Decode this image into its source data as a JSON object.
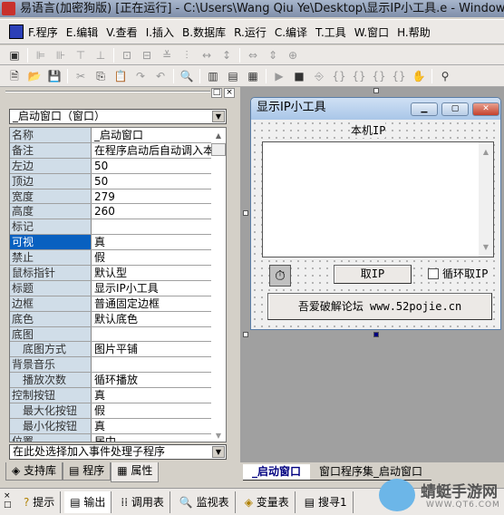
{
  "title": "易语言(加密狗版) [正在运行] - C:\\Users\\Wang Qiu Ye\\Desktop\\显示IP小工具.e - Windows窗口程",
  "menu": [
    "F.程序",
    "E.编辑",
    "V.查看",
    "I.插入",
    "B.数据库",
    "R.运行",
    "C.编译",
    "T.工具",
    "W.窗口",
    "H.帮助"
  ],
  "properties": {
    "object_combo": "_启动窗口（窗口）",
    "rows": [
      {
        "k": "名称",
        "v": "_启动窗口"
      },
      {
        "k": "备注",
        "v": "在程序启动后自动调入本"
      },
      {
        "k": "左边",
        "v": "50"
      },
      {
        "k": "顶边",
        "v": "50"
      },
      {
        "k": "宽度",
        "v": "279"
      },
      {
        "k": "高度",
        "v": "260"
      },
      {
        "k": "标记",
        "v": ""
      },
      {
        "k": "可视",
        "v": "真"
      },
      {
        "k": "禁止",
        "v": "假"
      },
      {
        "k": "鼠标指针",
        "v": "默认型"
      },
      {
        "k": "标题",
        "v": "显示IP小工具"
      },
      {
        "k": "边框",
        "v": "普通固定边框"
      },
      {
        "k": "底色",
        "v": "默认底色"
      },
      {
        "k": "底图",
        "v": ""
      },
      {
        "k": "底图方式",
        "v": "图片平铺"
      },
      {
        "k": "背景音乐",
        "v": ""
      },
      {
        "k": "播放次数",
        "v": "循环播放"
      },
      {
        "k": "控制按钮",
        "v": "真"
      },
      {
        "k": "最大化按钮",
        "v": "假"
      },
      {
        "k": "最小化按钮",
        "v": "真"
      },
      {
        "k": "位置",
        "v": "居中"
      }
    ],
    "event_combo": "在此处选择加入事件处理子程序"
  },
  "left_tabs": [
    "支持库",
    "程序",
    "属性"
  ],
  "form": {
    "title": "显示IP小工具",
    "label": "本机IP",
    "get_ip": "取IP",
    "loop_checkbox": "循环取IP",
    "loop_checked": false,
    "link_button": "吾爱破解论坛 www.52pojie.cn"
  },
  "design_tabs": [
    "_启动窗口",
    "窗口程序集_启动窗口"
  ],
  "output_tabs": [
    "提示",
    "输出",
    "调用表",
    "监视表",
    "变量表",
    "搜寻1"
  ],
  "watermark": {
    "text": "蜻蜓手游网",
    "url": "WWW.QT6.COM"
  }
}
